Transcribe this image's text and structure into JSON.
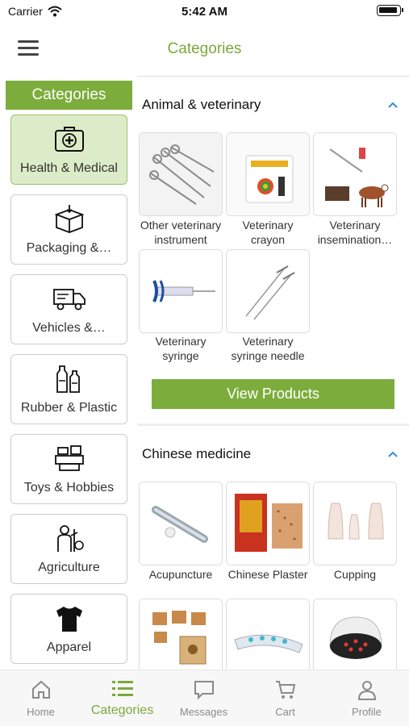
{
  "status": {
    "carrier": "Carrier",
    "time": "5:42 AM"
  },
  "header": {
    "title": "Categories"
  },
  "sidebar": {
    "title": "Categories",
    "items": [
      {
        "label": "Health & Medical",
        "icon": "first-aid-kit-icon",
        "active": true
      },
      {
        "label": "Packaging &…",
        "icon": "box-icon"
      },
      {
        "label": "Vehicles &…",
        "icon": "truck-icon"
      },
      {
        "label": "Rubber & Plastic",
        "icon": "bottles-icon"
      },
      {
        "label": "Toys & Hobbies",
        "icon": "toys-icon"
      },
      {
        "label": "Agriculture",
        "icon": "farmer-icon"
      },
      {
        "label": "Apparel",
        "icon": "tshirt-icon"
      }
    ]
  },
  "sections": [
    {
      "title": "Animal & veterinary",
      "expanded": true,
      "items": [
        {
          "line1": "Other veterinary",
          "line2": "instrument",
          "icon": "surgical-instruments-image"
        },
        {
          "line1": "Veterinary",
          "line2": "crayon",
          "icon": "crayon-box-image"
        },
        {
          "line1": "Veterinary",
          "line2": "insemination…",
          "icon": "insemination-kit-image"
        },
        {
          "line1": "Veterinary",
          "line2": "syringe",
          "icon": "syringe-image"
        },
        {
          "line1": "Veterinary",
          "line2": "syringe needle",
          "icon": "needle-image"
        }
      ],
      "button": "View Products"
    },
    {
      "title": "Chinese medicine",
      "expanded": true,
      "items": [
        {
          "line1": "Acupuncture",
          "line2": "",
          "icon": "acupuncture-pen-image"
        },
        {
          "line1": "Chinese Plaster",
          "line2": "",
          "icon": "plaster-image"
        },
        {
          "line1": "Cupping",
          "line2": "",
          "icon": "cupping-image"
        },
        {
          "line1": "",
          "line2": "",
          "icon": "moxibustion-box-image"
        },
        {
          "line1": "",
          "line2": "",
          "icon": "massage-device-image"
        },
        {
          "line1": "",
          "line2": "",
          "icon": "heat-lamp-image"
        }
      ]
    }
  ],
  "tabbar": [
    {
      "label": "Home",
      "icon": "home-icon"
    },
    {
      "label": "Categories",
      "icon": "list-icon",
      "active": true
    },
    {
      "label": "Messages",
      "icon": "chat-icon"
    },
    {
      "label": "Cart",
      "icon": "cart-icon"
    },
    {
      "label": "Profile",
      "icon": "person-icon"
    }
  ],
  "colors": {
    "accent": "#7cad3c",
    "active_bg": "#dcecc8",
    "chevron": "#2f8fd8"
  }
}
